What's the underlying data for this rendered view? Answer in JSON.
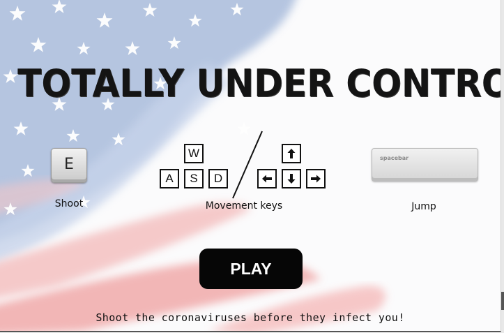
{
  "title": "TOTALLY UNDER CONTROL...",
  "controls": {
    "shoot": {
      "key": "E",
      "label": "Shoot"
    },
    "movement": {
      "wasd": [
        "W",
        "A",
        "S",
        "D"
      ],
      "arrows": [
        "up-arrow-icon",
        "left-arrow-icon",
        "down-arrow-icon",
        "right-arrow-icon"
      ],
      "label": "Movement keys"
    },
    "jump": {
      "key": "spacebar",
      "label": "Jump"
    }
  },
  "play_button": "PLAY",
  "tagline": "Shoot the coronaviruses before they infect you!",
  "colors": {
    "flag_red": "#f2a3a3",
    "flag_blue": "#9fb4d8",
    "text": "#111111",
    "button_bg": "#060606",
    "button_text": "#ffffff"
  }
}
